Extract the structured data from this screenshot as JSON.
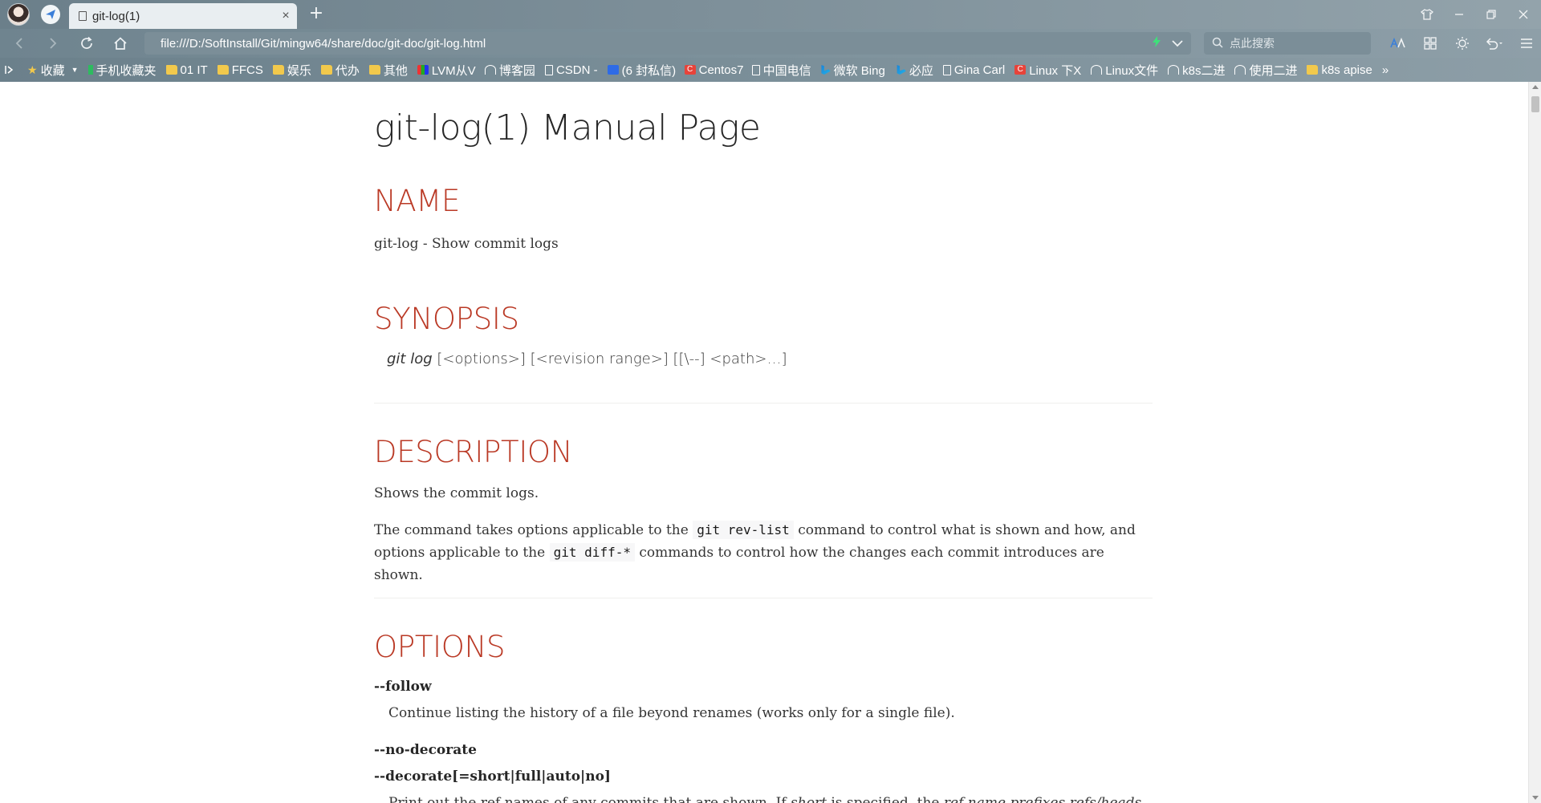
{
  "browser": {
    "tab_title": "git-log(1)",
    "tab_close": "×",
    "new_tab": "+",
    "url": "file:///D:/SoftInstall/Git/mingw64/share/doc/git-doc/git-log.html",
    "search_placeholder": "点此搜索",
    "bookmarks_more": "»",
    "bookmarks": [
      {
        "label": "收藏",
        "icon": "star-icon"
      },
      {
        "label": "手机收藏夹",
        "icon": "phone-icon"
      },
      {
        "label": "01 IT",
        "icon": "folder-icon"
      },
      {
        "label": "FFCS",
        "icon": "folder-icon"
      },
      {
        "label": "娱乐",
        "icon": "folder-icon"
      },
      {
        "label": "代办",
        "icon": "folder-icon"
      },
      {
        "label": "其他",
        "icon": "folder-icon"
      },
      {
        "label": "LVM从V",
        "icon": "site-icon"
      },
      {
        "label": "博客园",
        "icon": "site-icon"
      },
      {
        "label": "CSDN -",
        "icon": "page-icon"
      },
      {
        "label": "(6 封私信)",
        "icon": "zhihu-icon"
      },
      {
        "label": "Centos7",
        "icon": "csdn-icon"
      },
      {
        "label": "中国电信",
        "icon": "page-icon"
      },
      {
        "label": "微软 Bing",
        "icon": "bing-icon"
      },
      {
        "label": "必应",
        "icon": "bing-icon"
      },
      {
        "label": "Gina Carl",
        "icon": "page-icon"
      },
      {
        "label": "Linux 下X",
        "icon": "csdn-icon"
      },
      {
        "label": "Linux文件",
        "icon": "site-icon"
      },
      {
        "label": "k8s二进",
        "icon": "site-icon"
      },
      {
        "label": "使用二进",
        "icon": "site-icon"
      },
      {
        "label": "k8s apise",
        "icon": "folder-icon"
      }
    ]
  },
  "page": {
    "title": "git-log(1) Manual Page",
    "sections": {
      "name": {
        "heading": "NAME",
        "text": "git-log - Show commit logs"
      },
      "synopsis": {
        "heading": "SYNOPSIS",
        "command": "git log",
        "args": "[<options>] [<revision range>] [[\\--] <path>…​]"
      },
      "description": {
        "heading": "DESCRIPTION",
        "p1": "Shows the commit logs.",
        "p2_a": "The command takes options applicable to the",
        "p2_code1": "git rev-list",
        "p2_b": "command to control what is shown and how, and options applicable to the",
        "p2_code2": "git diff-*",
        "p2_c": "commands to control how the changes each commit introduces are shown."
      },
      "options": {
        "heading": "OPTIONS",
        "follow_term": "--follow",
        "follow_desc": "Continue listing the history of a file beyond renames (works only for a single file).",
        "no_decorate_term": "--no-decorate",
        "decorate_term": "--decorate[=short|full|auto|no]",
        "decorate_desc_a": "Print out the ref names of any commits that are shown. If",
        "decorate_desc_short": "short",
        "decorate_desc_b": "is specified, the",
        "decorate_desc_prefixes": "ref name prefixes refs/heads/, refs/tags/"
      }
    }
  }
}
